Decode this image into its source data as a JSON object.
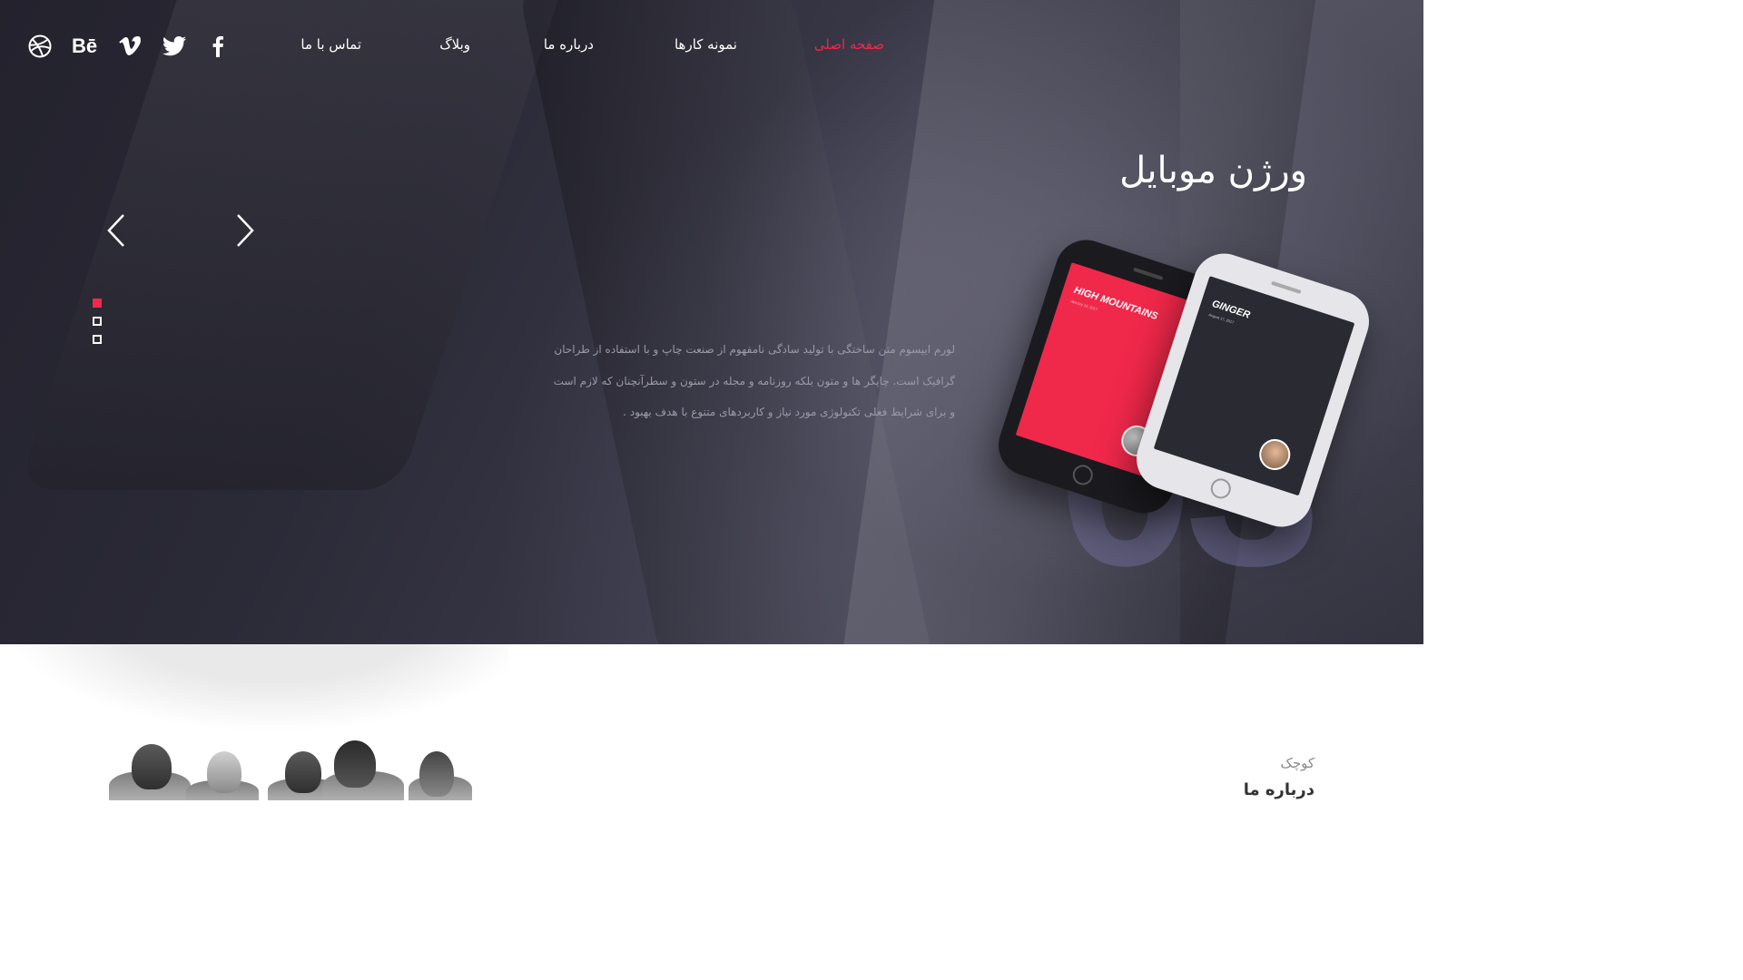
{
  "nav": {
    "items": [
      {
        "label": "صفحه اصلی",
        "active": true
      },
      {
        "label": "نمونه کارها",
        "active": false
      },
      {
        "label": "درباره ما",
        "active": false
      },
      {
        "label": "وبلاگ",
        "active": false
      },
      {
        "label": "تماس با ما",
        "active": false
      }
    ],
    "social": [
      {
        "icon": "facebook-icon"
      },
      {
        "icon": "twitter-icon"
      },
      {
        "icon": "vimeo-icon"
      },
      {
        "icon": "behance-icon",
        "text": "Bē"
      },
      {
        "icon": "dribbble-icon"
      }
    ]
  },
  "slider": {
    "title": "ورژن موبایل",
    "text_lines": [
      "لورم ایپسوم متن ساختگی با تولید سادگی نامفهوم از صنعت چاپ و با استفاده از طراحان",
      "گرافیک است. چاپگر ها و متون بلکه روزنامه و مجله در ستون و سطرآنچنان که لازم است",
      "و برای شرایط فعلی تکنولوژی مورد نیاز و کاربردهای متنوع با هدف بهبود ."
    ],
    "number": "03",
    "current_slide": 1,
    "total_slides": 3,
    "phone_screens": {
      "black": {
        "title": "HIGH MOUNTAINS",
        "sub": "January 12, 2017"
      },
      "white": {
        "title": "GINGER",
        "sub": "August 17, 2017"
      }
    }
  },
  "about": {
    "kicker": "کوچک",
    "title": "درباره ما"
  },
  "colors": {
    "accent": "#f0284a",
    "hero_dark": "#2b2a37",
    "text_muted": "#9a99a8"
  }
}
